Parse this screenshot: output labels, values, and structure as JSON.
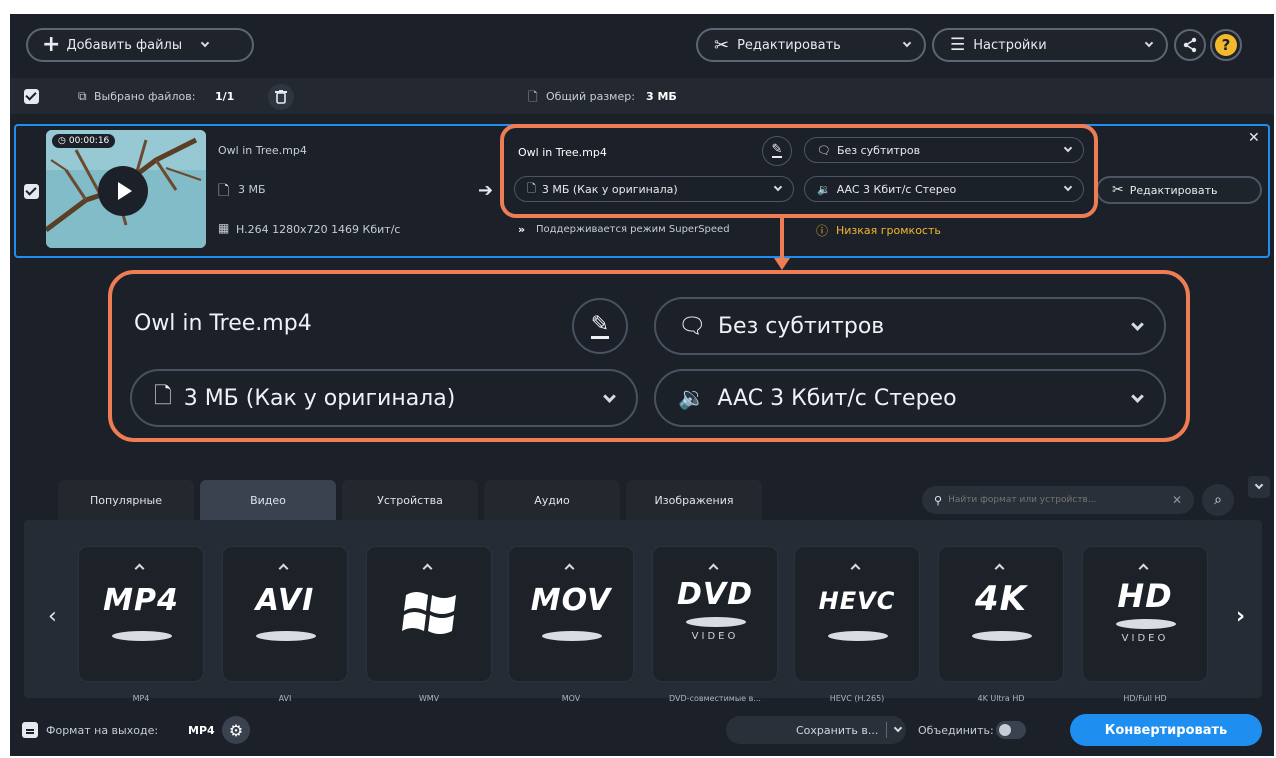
{
  "toolbar": {
    "add_files_label": "Добавить файлы",
    "edit_label": "Редактировать",
    "settings_label": "Настройки"
  },
  "selection_bar": {
    "selected_label": "Выбрано файлов:",
    "selected_value": "1/1",
    "total_size_label": "Общий размер:",
    "total_size_value": "3 МБ"
  },
  "file_item": {
    "duration": "00:00:16",
    "name": "Owl in Tree.mp4",
    "size": "3 МБ",
    "codec_info": "H.264 1280x720 1469 Кбит/с",
    "output_name": "Owl in Tree.mp4",
    "output_size": "3 МБ (Как у оригинала)",
    "subtitles": "Без субтитров",
    "audio": "AAC 3 Кбит/с Стерео",
    "superspeed": "Поддерживается режим SuperSpeed",
    "low_volume": "Низкая громкость",
    "edit_button": "Редактировать"
  },
  "zoom_callout": {
    "output_name": "Owl in Tree.mp4",
    "output_size": "3 МБ (Как у оригинала)",
    "subtitles": "Без субтитров",
    "audio": "AAC 3 Кбит/с Стерео"
  },
  "format_tabs": [
    "Популярные",
    "Видео",
    "Устройства",
    "Аудио",
    "Изображения"
  ],
  "active_tab": "Видео",
  "search": {
    "placeholder": "Найти формат или устройств..."
  },
  "formats": [
    {
      "logo": "MP4",
      "label": "MP4"
    },
    {
      "logo": "AVI",
      "label": "AVI"
    },
    {
      "logo": "",
      "label": "WMV"
    },
    {
      "logo": "MOV",
      "label": "MOV"
    },
    {
      "logo": "DVD",
      "label": "DVD-совместимые в..."
    },
    {
      "logo": "HEVC",
      "label": "HEVC (H.265)"
    },
    {
      "logo": "4K",
      "label": "4K Ultra HD"
    },
    {
      "logo": "HD",
      "label": "HD/Full HD"
    }
  ],
  "bottom_bar": {
    "output_format_label": "Формат на выходе:",
    "output_format_value": "MP4",
    "save_to_label": "Сохранить в...",
    "merge_label": "Объединить:",
    "convert_label": "Конвертировать"
  },
  "colors": {
    "accent_blue": "#1e8ff0",
    "callout_orange": "#ee7d55",
    "warning_yellow": "#f2b92c",
    "background": "#1b2029"
  }
}
